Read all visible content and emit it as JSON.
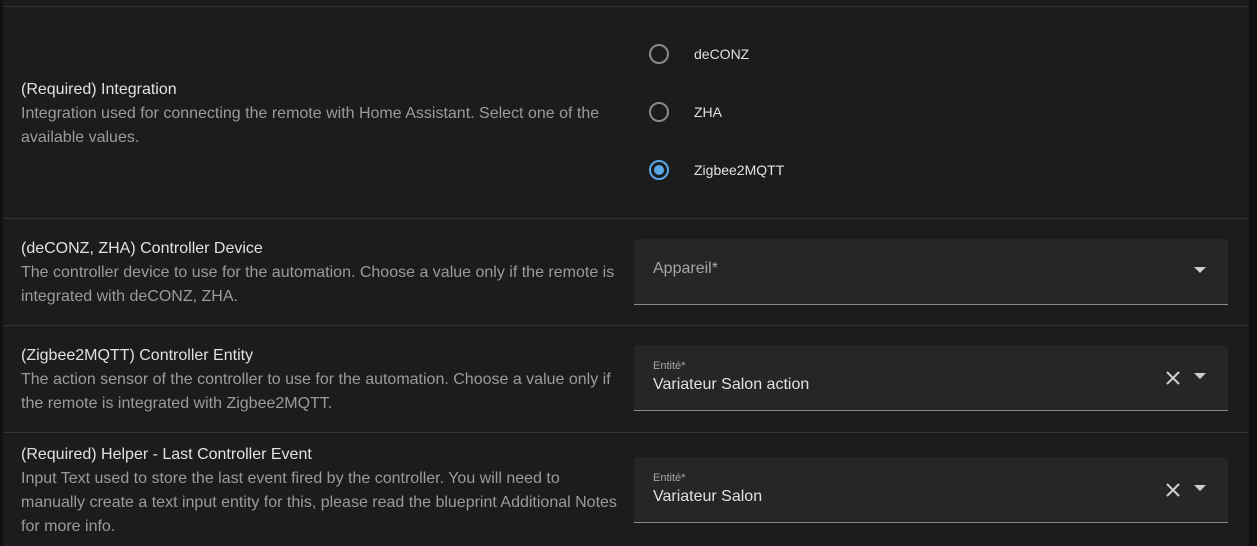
{
  "integration": {
    "title": "(Required) Integration",
    "description": "Integration used for connecting the remote with Home Assistant. Select one of the available values.",
    "options": [
      "deCONZ",
      "ZHA",
      "Zigbee2MQTT"
    ],
    "selected": "Zigbee2MQTT"
  },
  "controller_device": {
    "title": "(deCONZ, ZHA) Controller Device",
    "description": "The controller device to use for the automation. Choose a value only if the remote is integrated with deCONZ, ZHA.",
    "placeholder": "Appareil*",
    "icon_dropdown": "menu-down-icon"
  },
  "controller_entity": {
    "title": "(Zigbee2MQTT) Controller Entity",
    "description": "The action sensor of the controller to use for the automation. Choose a value only if the remote is integrated with Zigbee2MQTT.",
    "field_label": "Entité*",
    "value": "Variateur Salon action",
    "icon_clear": "close-icon",
    "icon_dropdown": "menu-down-icon"
  },
  "helper_last_event": {
    "title": "(Required) Helper - Last Controller Event",
    "description": "Input Text used to store the last event fired by the controller. You will need to manually create a text input entity for this, please read the blueprint Additional Notes for more info.",
    "field_label": "Entité*",
    "value": "Variateur Salon",
    "icon_clear": "close-icon",
    "icon_dropdown": "menu-down-icon"
  },
  "colors": {
    "background": "#1c1c1c",
    "accent": "#5aa7e8",
    "field_background": "#262626",
    "primary_text": "#e1e1e1",
    "secondary_text": "#9b9b9b"
  }
}
